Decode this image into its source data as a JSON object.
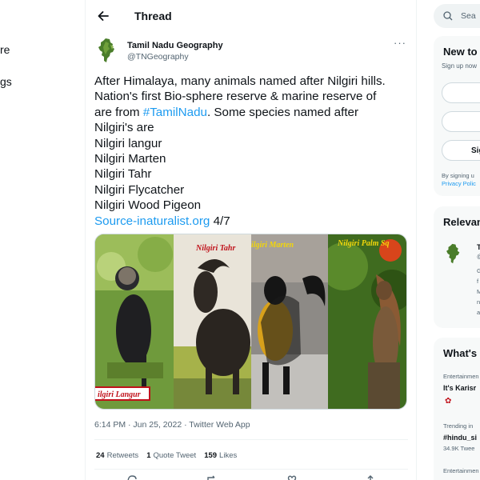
{
  "left_nav": {
    "frag_1": "re",
    "frag_2": "gs"
  },
  "header": {
    "title": "Thread"
  },
  "tweet": {
    "display_name": "Tamil Nadu Geography",
    "handle": "@TNGeography",
    "more_glyph": "···",
    "lines": [
      "After Himalaya, many animals named after Nilgiri hills.",
      "Nation's first Bio-sphere reserve & marine reserve of"
    ],
    "line3_prefix": "are from ",
    "hashtag": "#TamilNadu",
    "line3_suffix": ". Some species named after",
    "list_lines": [
      "Nilgiri's are",
      "Nilgiri langur",
      "Nilgiri Marten",
      "Nilgiri Tahr",
      "Nilgiri Flycatcher",
      "Nilgiri Wood Pigeon"
    ],
    "source_link": "Source-inaturalist.org",
    "counter": " 4/7",
    "image_captions": {
      "langur": "ilgiri Langur",
      "tahr": "Nilgiri Tahr",
      "marten": "ilgiri Marten",
      "squirrel": "Nilgiri Palm Sq"
    },
    "timestamp": "6:14 PM · Jun 25, 2022 · Twitter Web App",
    "stats": {
      "retweets_count": "24",
      "retweets_label": "Retweets",
      "quotes_count": "1",
      "quotes_label": "Quote Tweet",
      "likes_count": "159",
      "likes_label": "Likes"
    }
  },
  "right": {
    "search_placeholder": "Sea",
    "new_card_title": "New to",
    "new_card_sub": "Sign up now",
    "signup_btn": "Sig",
    "terms_1": "By signing u",
    "terms_2": "Privacy Polic",
    "relevant_title": "Relevan",
    "relevant_frag_T": "T",
    "relevant_frag_at": "@",
    "relevant_frags": [
      "G",
      "f",
      "M",
      "n",
      "a"
    ],
    "whats_title": "What's",
    "trend_1_cat": "Entertainmen",
    "trend_1_name": "It's Karisr",
    "trend_2_cat": "Trending in",
    "trend_2_name": "#hindu_si",
    "trend_2_count": "34.9K Twee",
    "trend_3_cat": "Entertainmen"
  },
  "colors": {
    "accent": "#1d9bf0",
    "text": "#0f1419",
    "muted": "#536471",
    "caption_red": "#c0121b",
    "caption_gold": "#f2d60b"
  }
}
